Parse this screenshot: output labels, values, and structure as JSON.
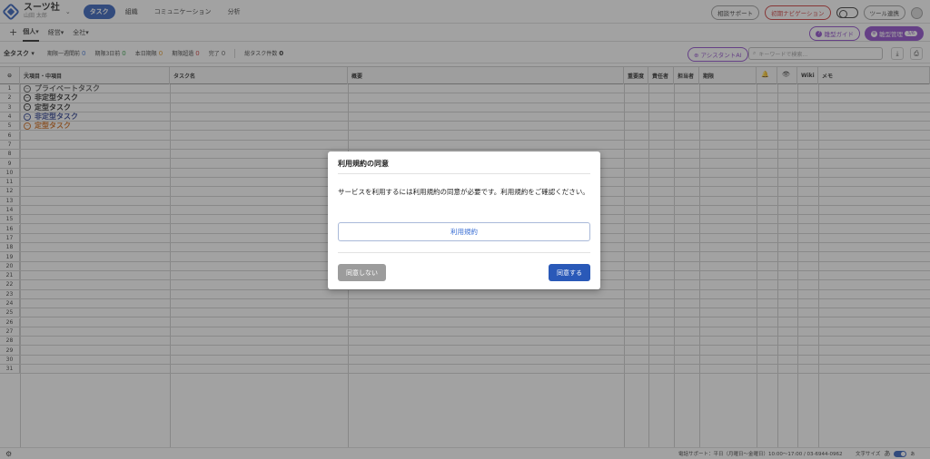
{
  "header": {
    "company_name": "スーツ社",
    "user_name": "山田 太郎",
    "nav_tabs": [
      {
        "label": "タスク",
        "active": true
      },
      {
        "label": "組織",
        "active": false
      },
      {
        "label": "コミュニケーション",
        "active": false
      },
      {
        "label": "分析",
        "active": false
      }
    ],
    "consult_support": "相談サポート",
    "initial_navigation": "初期ナビゲーション",
    "tool_link": "ツール連携"
  },
  "subbar": {
    "view_tabs": [
      {
        "label": "個人",
        "active": true
      },
      {
        "label": "経営",
        "active": false
      },
      {
        "label": "全社",
        "active": false
      }
    ],
    "template_guide": "雛型ガイド",
    "template_manage": "雛型管理",
    "template_manage_badge": "3/6"
  },
  "filterbar": {
    "all_tasks": "全タスク",
    "stats": [
      {
        "label": "期限一週間前",
        "value": "0",
        "color": "blue"
      },
      {
        "label": "期限3日前",
        "value": "0",
        "color": "green"
      },
      {
        "label": "本日期限",
        "value": "0",
        "color": "orange"
      },
      {
        "label": "期限超過",
        "value": "0",
        "color": "red"
      },
      {
        "label": "完了",
        "value": "0",
        "color": "gray"
      },
      {
        "label": "総タスク件数",
        "value": "0",
        "color": "dark"
      }
    ],
    "assistant_ai": "アシスタントAI",
    "search_placeholder": "キーワードで検索..."
  },
  "grid": {
    "columns": [
      {
        "label": "大項目・中項目"
      },
      {
        "label": "タスク名"
      },
      {
        "label": "概要"
      },
      {
        "label": "重要度"
      },
      {
        "label": "責任者"
      },
      {
        "label": "担当者"
      },
      {
        "label": "期限"
      },
      {
        "label": ""
      },
      {
        "label": ""
      },
      {
        "label": "Wiki"
      },
      {
        "label": "メモ"
      }
    ],
    "groups": [
      {
        "label": "プライベートタスク",
        "color": "#555555"
      },
      {
        "label": "非定型タスク",
        "color": "#222222"
      },
      {
        "label": "定型タスク",
        "color": "#222222"
      },
      {
        "label": "非定型タスク",
        "color": "#2a3d8f"
      },
      {
        "label": "定型タスク",
        "color": "#d06a1a"
      }
    ],
    "row_count": 31
  },
  "statusbar": {
    "phone_support": "電話サポート：平日（月曜日〜金曜日）10:00〜17:00 / 03-6944-0962",
    "font_size_label": "文字サイズ",
    "font_small": "あ",
    "font_large": "あ"
  },
  "modal": {
    "title": "利用規約の同意",
    "body": "サービスを利用するには利用規約の同意が必要です。利用規約をご確認ください。",
    "terms_link": "利用規約",
    "deny_label": "同意しない",
    "agree_label": "同意する"
  },
  "colors": {
    "primary": "#2a59b8",
    "accent_purple": "#8a43c9"
  }
}
